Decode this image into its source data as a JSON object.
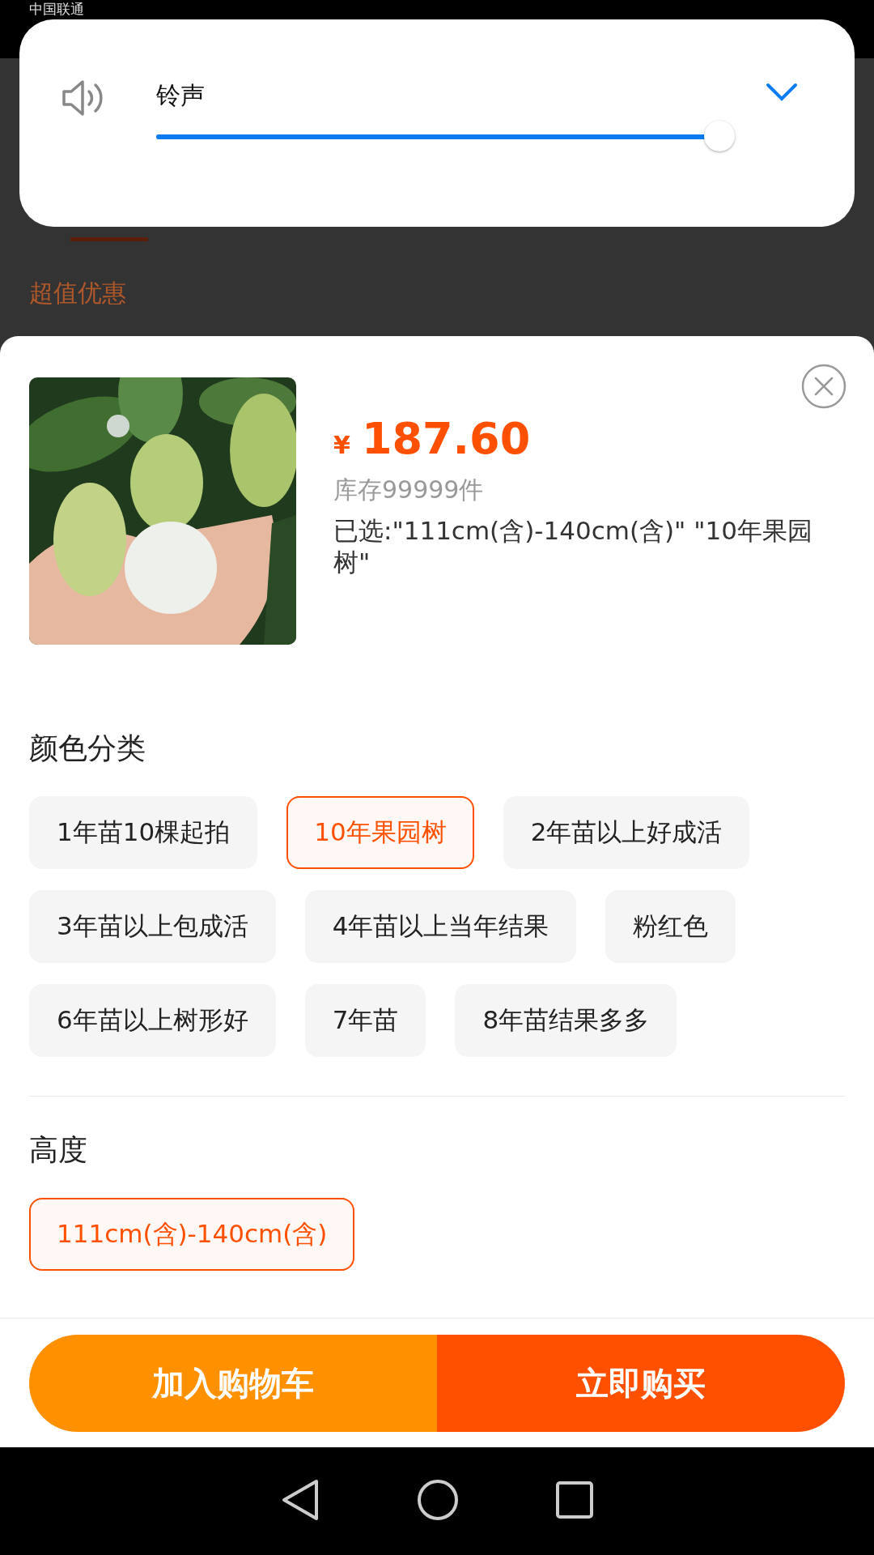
{
  "status_bar": {
    "carrier": "中国联通"
  },
  "volume_panel": {
    "label": "铃声",
    "level": 1
  },
  "background": {
    "section_title": "超值优惠"
  },
  "sheet": {
    "price_symbol": "¥",
    "price": "187.60",
    "stock": "库存99999件",
    "selected_text": "已选:\"111cm(含)-140cm(含)\" \"10年果园树\"",
    "groups": [
      {
        "title": "颜色分类",
        "options": [
          {
            "label": "1年苗10棵起拍",
            "selected": false
          },
          {
            "label": "10年果园树",
            "selected": true
          },
          {
            "label": "2年苗以上好成活",
            "selected": false
          },
          {
            "label": "3年苗以上包成活",
            "selected": false
          },
          {
            "label": "4年苗以上当年结果",
            "selected": false
          },
          {
            "label": "粉红色",
            "selected": false
          },
          {
            "label": "6年苗以上树形好",
            "selected": false
          },
          {
            "label": "7年苗",
            "selected": false
          },
          {
            "label": "8年苗结果多多",
            "selected": false
          }
        ]
      },
      {
        "title": "高度",
        "options": [
          {
            "label": "111cm(含)-140cm(含)",
            "selected": true
          }
        ]
      }
    ],
    "buttons": [
      {
        "kind": "cart",
        "label": "加入购物车"
      },
      {
        "kind": "buy",
        "label": "立即购买"
      }
    ]
  }
}
